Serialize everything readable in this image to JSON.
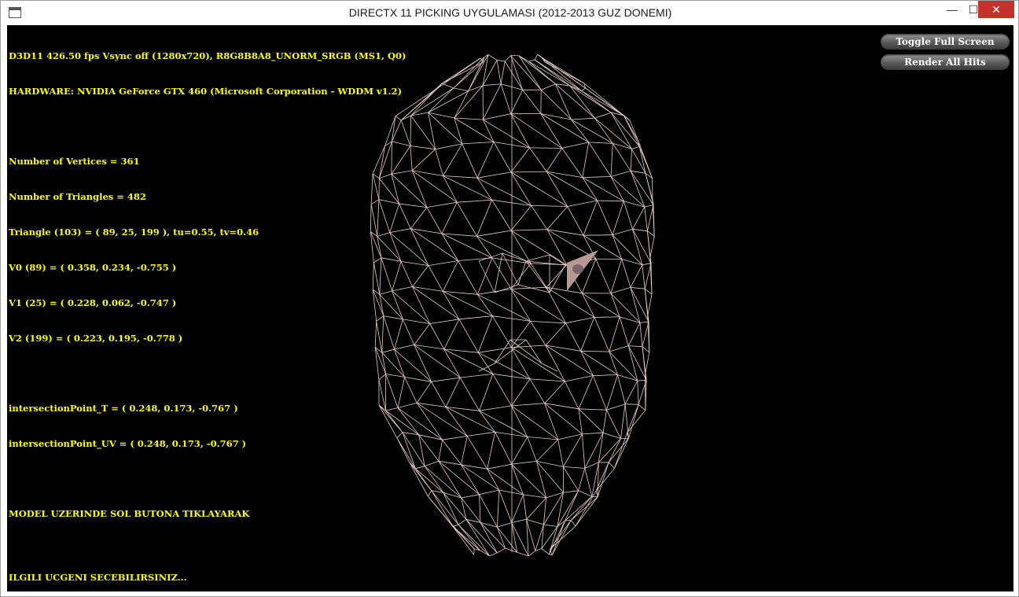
{
  "window": {
    "title": "DIRECTX 11 PICKING UYGULAMASI (2012-2013 GUZ DONEMI)",
    "controls": {
      "minimize": "—",
      "maximize": "☐",
      "close": "✕"
    }
  },
  "hud": {
    "stats": "D3D11 426.50 fps Vsync off (1280x720), R8G8B8A8_UNORM_SRGB (MS1, Q0)",
    "hardware": "HARDWARE: NVIDIA GeForce GTX 460 (Microsoft Corporation - WDDM v1.2)",
    "vertices": "Number of Vertices = 361",
    "triangles": "Number of Triangles = 482",
    "triangle": "Triangle (103) = ( 89, 25, 199 ), tu=0.55, tv=0.46",
    "v0": "V0 (89) = ( 0.358, 0.234, -0.755 )",
    "v1": "V1 (25) = ( 0.228, 0.062, -0.747 )",
    "v2": "V2 (199) = ( 0.223, 0.195, -0.778 )",
    "intersection_t": "intersectionPoint_T = ( 0.248, 0.173, -0.767 )",
    "intersection_uv": "intersectionPoint_UV = ( 0.248, 0.173, -0.767 )",
    "instruction_1": "MODEL UZERINDE SOL BUTONA TIKLAYARAK",
    "instruction_2": "ILGILI UCGENI SECEBILIRSINIZ..."
  },
  "buttons": {
    "toggle_full_screen": "Toggle Full Screen",
    "render_all_hits": "Render All Hits"
  },
  "colors": {
    "hud_text": "#ffff00",
    "wireframe": "#e8cfc8",
    "viewport_bg": "#000000",
    "close_button": "#c7312b"
  }
}
